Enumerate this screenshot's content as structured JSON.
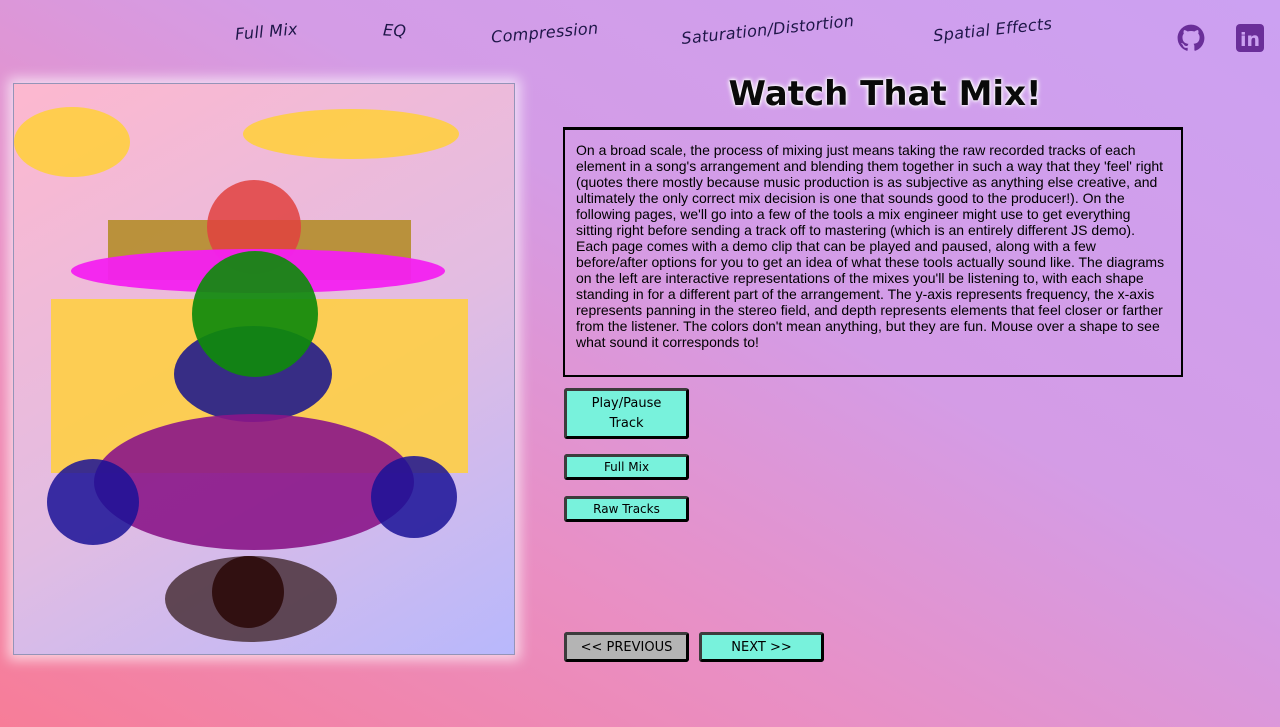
{
  "nav": {
    "items": [
      {
        "label": "Full Mix"
      },
      {
        "label": "EQ"
      },
      {
        "label": "Compression"
      },
      {
        "label": "Saturation/Distortion"
      },
      {
        "label": "Spatial Effects"
      }
    ],
    "github_icon": "github-icon",
    "linkedin_icon": "linkedin-icon",
    "linkedin_text": "in"
  },
  "main": {
    "title": "Watch That Mix!",
    "description": "On a broad scale, the process of mixing just means taking the raw recorded tracks of each element in a song's arrangement and blending them together in such a way that they 'feel' right (quotes there mostly because music production is as subjective as anything else creative, and ultimately the only correct mix decision is one that sounds good to the producer!). On the following pages, we'll go into a few of the tools a mix engineer might use to get everything sitting right before sending a track off to mastering (which is an entirely different JS demo). Each page comes with a demo clip that can be played and paused, along with a few before/after options for you to get an idea of what these tools actually sound like. The diagrams on the left are interactive representations of the mixes you'll be listening to, with each shape standing in for a different part of the arrangement. The y-axis represents frequency, the x-axis represents panning in the stereo field, and depth represents elements that feel closer or farther from the listener. The colors don't mean anything, but they are fun. Mouse over a shape to see what sound it corresponds to!"
  },
  "buttons": {
    "play_pause": "Play/Pause Track",
    "full_mix": "Full Mix",
    "raw_tracks": "Raw Tracks",
    "previous": "<< PREVIOUS",
    "next": "NEXT >>"
  },
  "colors": {
    "button_accent": "#78f2dc",
    "button_disabled": "#b4b4b4",
    "nav_text": "#1e1648",
    "icon_color": "#6a2e99"
  }
}
